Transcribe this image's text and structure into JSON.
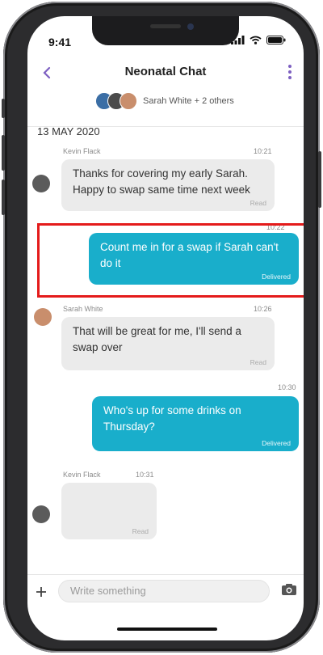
{
  "status_bar": {
    "time": "9:41"
  },
  "header": {
    "title": "Neonatal Chat",
    "members_label": "Sarah White + 2 others"
  },
  "date_divider": "13 MAY 2020",
  "messages": [
    {
      "sender": "Kevin Flack",
      "time": "10:21",
      "text1": "Thanks for covering my early Sarah.",
      "text2": "Happy to swap same time next week",
      "status": "Read"
    },
    {
      "time": "10:22",
      "text1": "Count me in for a swap if Sarah can't",
      "text2": "do it",
      "status": "Delivered"
    },
    {
      "sender": "Sarah White",
      "time": "10:26",
      "text1": "That will be great for me, I'll send a",
      "text2": "swap over",
      "status": "Read"
    },
    {
      "time": "10:30",
      "text1": "Who's up for some drinks on",
      "text2": "Thursday?",
      "status": "Delivered"
    },
    {
      "sender": "Kevin Flack",
      "time": "10:31",
      "status": "Read"
    }
  ],
  "input": {
    "placeholder": "Write something"
  },
  "colors": {
    "accent": "#7d5fc1",
    "outgoing_bubble": "#19aecb",
    "incoming_bubble": "#ebebeb",
    "highlight": "#e41b1b"
  }
}
